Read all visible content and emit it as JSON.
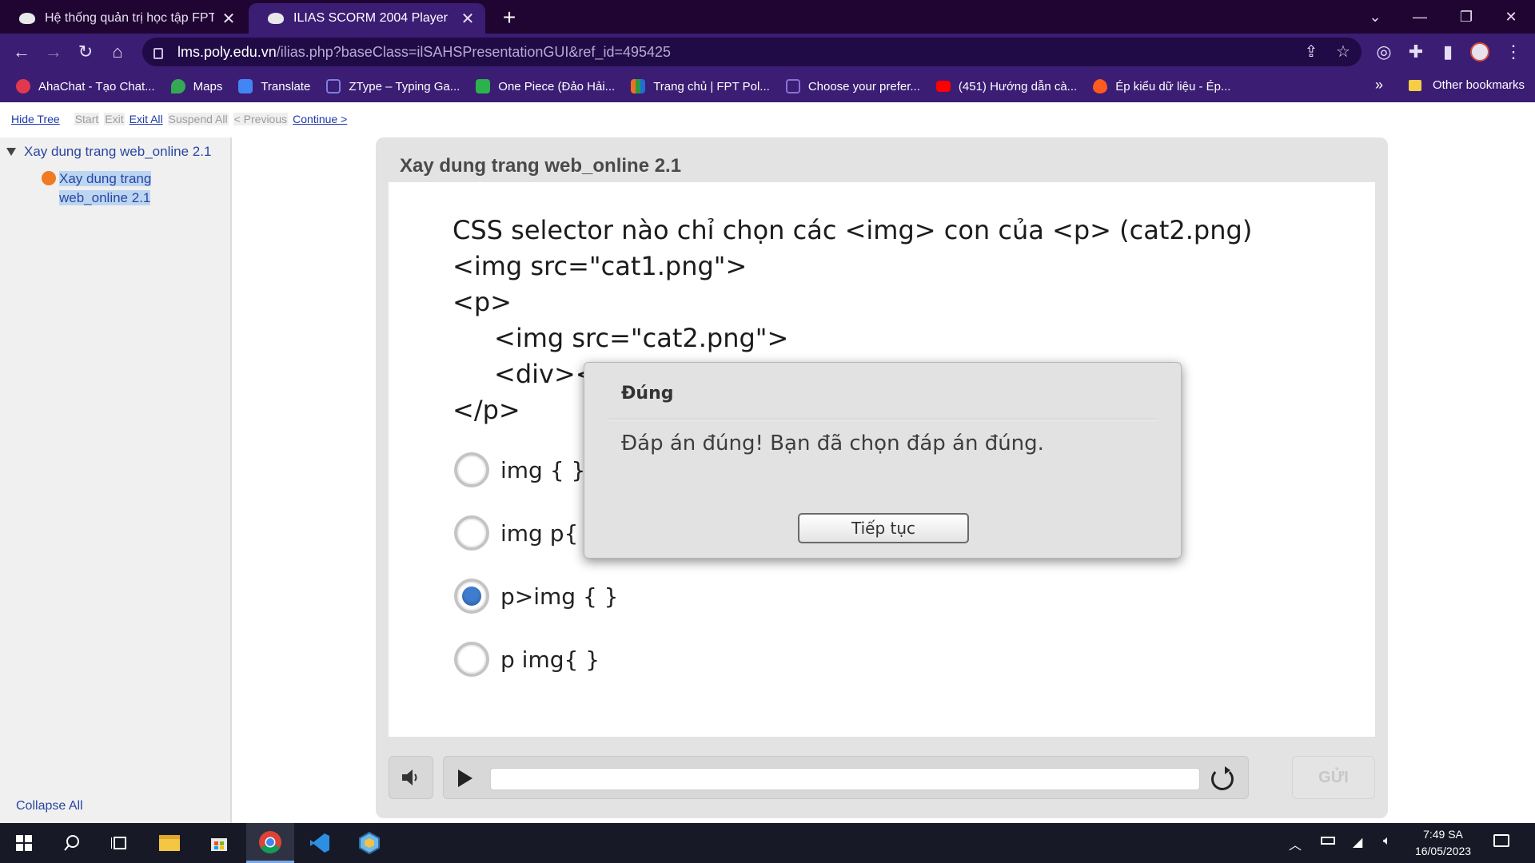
{
  "browser": {
    "tabs": [
      {
        "title": "Hệ thống quản trị học tập FPT Po",
        "active": false
      },
      {
        "title": "ILIAS SCORM 2004 Player",
        "active": true
      }
    ],
    "url_host": "lms.poly.edu.vn",
    "url_path": "/ilias.php?baseClass=ilSAHSPresentationGUI&ref_id=495425",
    "bookmarks": [
      {
        "label": "AhaChat - Tạo Chat...",
        "color": "#e2384d"
      },
      {
        "label": "Maps",
        "color": "#34a853"
      },
      {
        "label": "Translate",
        "color": "#4285f4"
      },
      {
        "label": "ZType – Typing Ga...",
        "color": "#7b7fe0"
      },
      {
        "label": "One Piece (Đảo Hải...",
        "color": "#2bb24c"
      },
      {
        "label": "Trang chủ | FPT Pol...",
        "color": "#f26f21"
      },
      {
        "label": "Choose your prefer...",
        "color": "#8b6fd8"
      },
      {
        "label": "(451) Hướng dẫn cà...",
        "color": "#ff0000"
      },
      {
        "label": "Ép kiểu dữ liệu - Ép...",
        "color": "#ff5a1f"
      }
    ],
    "bookmarks_more": "»",
    "other_bookmarks": "Other bookmarks"
  },
  "scorm_nav": {
    "hide_tree": "Hide Tree",
    "start": "Start",
    "exit": "Exit",
    "exit_all": "Exit All",
    "suspend_all": "Suspend All",
    "previous": "< Previous",
    "continue": "Continue >"
  },
  "tree": {
    "root": "Xay dung trang web_online 2.1",
    "child": "Xay dung trang web_online 2.1",
    "collapse_all": "Collapse All"
  },
  "player": {
    "title": "Xay dung trang web_online 2.1",
    "question_lines": [
      "CSS selector nào chỉ chọn các <img> con của <p> (cat2.png)",
      "<img src=\"cat1.png\">",
      "<p>",
      "<img src=\"cat2.png\">",
      "<div><i",
      "</p>"
    ],
    "options": [
      {
        "label": "img { }",
        "checked": false
      },
      {
        "label": "img p{ }",
        "checked": false
      },
      {
        "label": "p>img { }",
        "checked": true
      },
      {
        "label": "p img{ }",
        "checked": false
      }
    ],
    "dialog": {
      "title": "Đúng",
      "message": "Đáp án đúng!  Bạn đã chọn đáp án đúng.",
      "button": "Tiếp tục"
    },
    "progress": 0,
    "submit_label": "GỬI"
  },
  "taskbar": {
    "time": "7:49 SA",
    "date": "16/05/2023"
  }
}
